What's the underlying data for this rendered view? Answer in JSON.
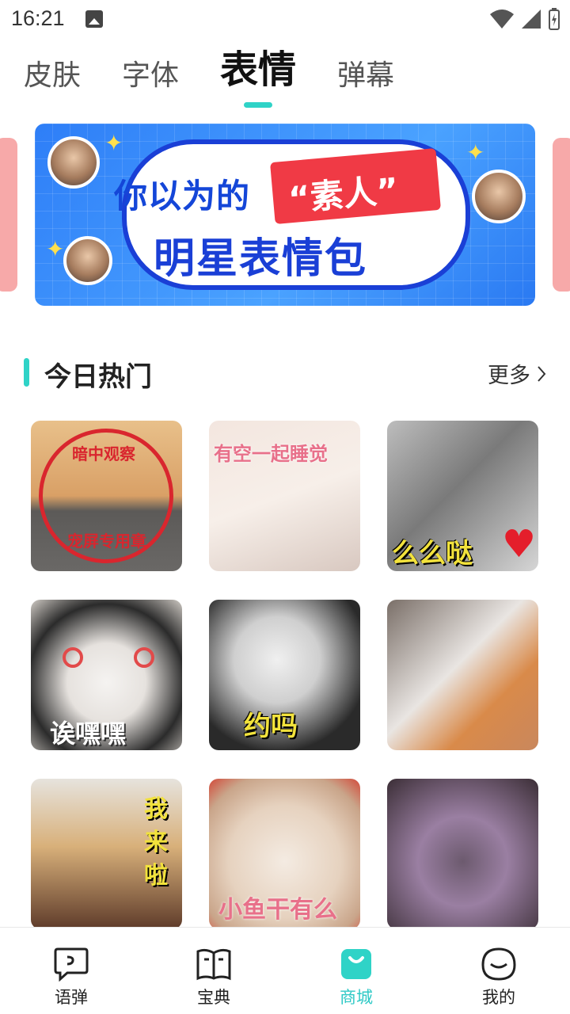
{
  "status_bar": {
    "time": "16:21"
  },
  "top_tabs": [
    {
      "label": "皮肤",
      "active": false
    },
    {
      "label": "字体",
      "active": false
    },
    {
      "label": "表情",
      "active": true
    },
    {
      "label": "弹幕",
      "active": false
    }
  ],
  "banner": {
    "line1": "你以为的",
    "highlight": "“素人”",
    "line2": "明星表情包",
    "colors": {
      "background": "#2e7ef7",
      "text": "#1446d8",
      "highlight": "#f03a45"
    }
  },
  "section": {
    "title": "今日热门",
    "more_label": "更多"
  },
  "stickers": [
    {
      "caption_top": "暗中观察",
      "caption_bottom": "宠屏专用章"
    },
    {
      "caption": "有空一起睡觉"
    },
    {
      "caption": "么么哒"
    },
    {
      "caption": "诶嘿嘿"
    },
    {
      "caption": "约吗"
    },
    {
      "caption": ""
    },
    {
      "caption": "我来啦"
    },
    {
      "caption": "小鱼干有么"
    },
    {
      "caption": ""
    }
  ],
  "bottom_nav": [
    {
      "label": "语弹",
      "icon": "chat-bubble-icon",
      "active": false
    },
    {
      "label": "宝典",
      "icon": "book-icon",
      "active": false
    },
    {
      "label": "商城",
      "icon": "shopping-bag-icon",
      "active": true
    },
    {
      "label": "我的",
      "icon": "smiley-face-icon",
      "active": false
    }
  ],
  "accent_color": "#2fd3c7"
}
